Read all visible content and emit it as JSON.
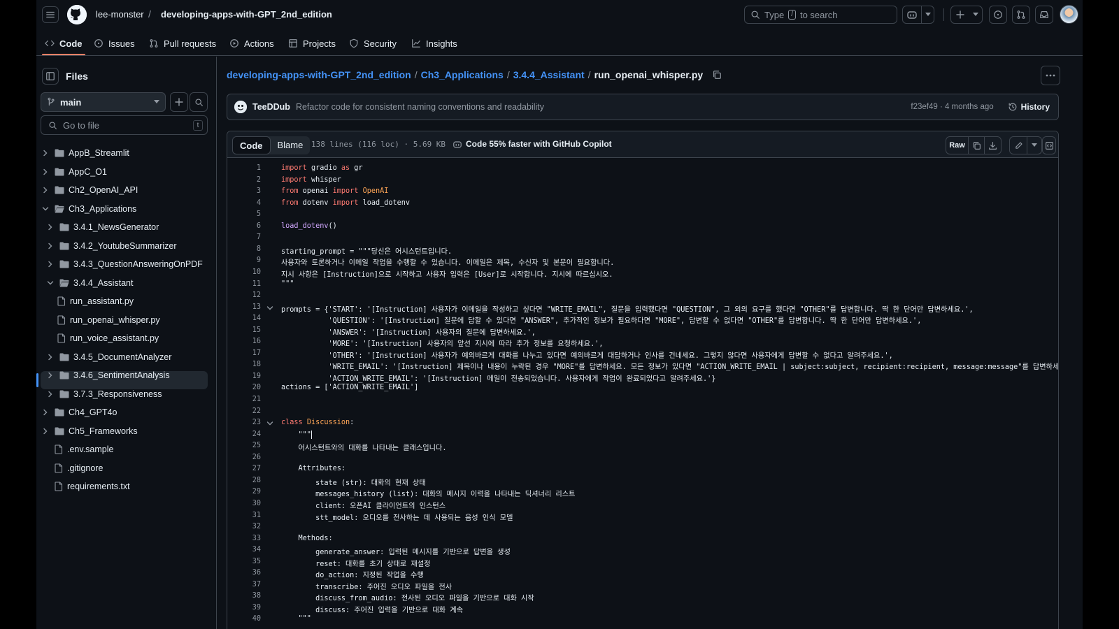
{
  "header": {
    "owner": "lee-monster",
    "separator": "/",
    "repo": "developing-apps-with-GPT_2nd_edition",
    "search_prefix": "Type",
    "search_key": "/",
    "search_suffix": "to search"
  },
  "repo_nav": {
    "tabs": [
      {
        "label": "Code",
        "icon": "code-icon"
      },
      {
        "label": "Issues",
        "icon": "issue-icon"
      },
      {
        "label": "Pull requests",
        "icon": "pull-request-icon"
      },
      {
        "label": "Actions",
        "icon": "play-icon"
      },
      {
        "label": "Projects",
        "icon": "table-icon"
      },
      {
        "label": "Security",
        "icon": "shield-icon"
      },
      {
        "label": "Insights",
        "icon": "graph-icon"
      }
    ]
  },
  "sidebar": {
    "title": "Files",
    "branch": "main",
    "goto_placeholder": "Go to file",
    "goto_key": "t",
    "tree": [
      {
        "label": "AppB_Streamlit",
        "type": "folder",
        "depth": 0,
        "expanded": false
      },
      {
        "label": "AppC_O1",
        "type": "folder",
        "depth": 0,
        "expanded": false
      },
      {
        "label": "Ch2_OpenAI_API",
        "type": "folder",
        "depth": 0,
        "expanded": false
      },
      {
        "label": "Ch3_Applications",
        "type": "folder",
        "depth": 0,
        "expanded": true
      },
      {
        "label": "3.4.1_NewsGenerator",
        "type": "folder",
        "depth": 1,
        "expanded": false
      },
      {
        "label": "3.4.2_YoutubeSummarizer",
        "type": "folder",
        "depth": 1,
        "expanded": false
      },
      {
        "label": "3.4.3_QuestionAnsweringOnPDF",
        "type": "folder",
        "depth": 1,
        "expanded": false
      },
      {
        "label": "3.4.4_Assistant",
        "type": "folder",
        "depth": 1,
        "expanded": true
      },
      {
        "label": "run_assistant.py",
        "type": "file",
        "depth": 2
      },
      {
        "label": "run_openai_whisper.py",
        "type": "file",
        "depth": 2,
        "selected": true
      },
      {
        "label": "run_voice_assistant.py",
        "type": "file",
        "depth": 2
      },
      {
        "label": "3.4.5_DocumentAnalyzer",
        "type": "folder",
        "depth": 1,
        "expanded": false
      },
      {
        "label": "3.4.6_SentimentAnalysis",
        "type": "folder",
        "depth": 1,
        "expanded": false
      },
      {
        "label": "3.7.3_Responsiveness",
        "type": "folder",
        "depth": 1,
        "expanded": false
      },
      {
        "label": "Ch4_GPT4o",
        "type": "folder",
        "depth": 0,
        "expanded": false
      },
      {
        "label": "Ch5_Frameworks",
        "type": "folder",
        "depth": 0,
        "expanded": false
      },
      {
        "label": ".env.sample",
        "type": "file",
        "depth": 0
      },
      {
        "label": ".gitignore",
        "type": "file",
        "depth": 0
      },
      {
        "label": "requirements.txt",
        "type": "file",
        "depth": 0
      }
    ]
  },
  "breadcrumb": {
    "parts": [
      "developing-apps-with-GPT_2nd_edition",
      "Ch3_Applications",
      "3.4.4_Assistant"
    ],
    "separator": "/",
    "current": "run_openai_whisper.py"
  },
  "commit": {
    "author": "TeeDDub",
    "message": "Refactor code for consistent naming conventions and readability",
    "meta": "f23ef49 · 4 months ago",
    "history_label": "History"
  },
  "file_bar": {
    "code_tab": "Code",
    "blame_tab": "Blame",
    "info": "138 lines (116 loc) · 5.69 KB",
    "copilot": "Code 55% faster with GitHub Copilot",
    "raw_label": "Raw"
  },
  "colors": {
    "bg": "#0d1117",
    "accent": "#4493f8",
    "tab_underline": "#f78166",
    "keyword": "#ff7b72",
    "function": "#d2a8ff",
    "string": "#a5d6ff"
  },
  "code_lines": [
    {
      "n": "1",
      "t": "import gradio as gr"
    },
    {
      "n": "2",
      "t": "import whisper"
    },
    {
      "n": "3",
      "t": "from openai import OpenAI"
    },
    {
      "n": "4",
      "t": "from dotenv import load_dotenv"
    },
    {
      "n": "5",
      "t": ""
    },
    {
      "n": "6",
      "t": "load_dotenv()"
    },
    {
      "n": "7",
      "t": ""
    },
    {
      "n": "8",
      "t": "starting_prompt = \"\"\"당신은 어시스턴트입니다."
    },
    {
      "n": "9",
      "t": "사용자와 토론하거나 이메일 작업을 수행할 수 있습니다. 이메일은 제목, 수신자 및 본문이 필요합니다."
    },
    {
      "n": "10",
      "t": "지시 사항은 [Instruction]으로 시작하고 사용자 입력은 [User]로 시작합니다. 지시에 따르십시오."
    },
    {
      "n": "11",
      "t": "\"\"\""
    },
    {
      "n": "12",
      "t": ""
    },
    {
      "n": "13",
      "t": "prompts = {'START': '[Instruction] 사용자가 이메일을 작성하고 싶다면 \"WRITE_EMAIL\", 질문을 입력했다면 \"QUESTION\", 그 외의 요구를 했다면 \"OTHER\"를 답변합니다. 딱 한 단어만 답변하세요.',"
    },
    {
      "n": "14",
      "t": "           'QUESTION': '[Instruction] 질문에 답할 수 있다면 \"ANSWER\", 추가적인 정보가 필요하다면 \"MORE\", 답변할 수 없다면 \"OTHER\"를 답변합니다. 딱 한 단어만 답변하세요.',"
    },
    {
      "n": "15",
      "t": "           'ANSWER': '[Instruction] 사용자의 질문에 답변하세요.',"
    },
    {
      "n": "16",
      "t": "           'MORE': '[Instruction] 사용자의 앞선 지시에 따라 추가 정보를 요청하세요.',"
    },
    {
      "n": "17",
      "t": "           'OTHER': '[Instruction] 사용자가 예의바르게 대화를 나누고 있다면 예의바르게 대답하거나 인사를 건네세요. 그렇지 않다면 사용자에게 답변할 수 없다고 알려주세요.',"
    },
    {
      "n": "18",
      "t": "           'WRITE_EMAIL': '[Instruction] 제목이나 내용이 누락된 경우 \"MORE\"를 답변하세요. 모든 정보가 있다면 \"ACTION_WRITE_EMAIL | subject:subject, recipient:recipient, message:message\"를 답변하세요.',"
    },
    {
      "n": "19",
      "t": "           'ACTION_WRITE_EMAIL': '[Instruction] 메일이 전송되었습니다. 사용자에게 작업이 완료되었다고 알려주세요.'}"
    },
    {
      "n": "20",
      "t": "actions = ['ACTION_WRITE_EMAIL']"
    },
    {
      "n": "21",
      "t": ""
    },
    {
      "n": "22",
      "t": ""
    },
    {
      "n": "23",
      "t": "class Discussion:"
    },
    {
      "n": "24",
      "t": "    \"\"\""
    },
    {
      "n": "25",
      "t": "    어시스턴트와의 대화를 나타내는 클래스입니다."
    },
    {
      "n": "26",
      "t": ""
    },
    {
      "n": "27",
      "t": "    Attributes:"
    },
    {
      "n": "28",
      "t": "        state (str): 대화의 현재 상태"
    },
    {
      "n": "29",
      "t": "        messages_history (list): 대화의 메시지 이력을 나타내는 딕셔너리 리스트"
    },
    {
      "n": "30",
      "t": "        client: 오픈AI 클라이언트의 인스턴스"
    },
    {
      "n": "31",
      "t": "        stt_model: 오디오를 전사하는 데 사용되는 음성 인식 모델"
    },
    {
      "n": "32",
      "t": ""
    },
    {
      "n": "33",
      "t": "    Methods:"
    },
    {
      "n": "34",
      "t": "        generate_answer: 입력된 메시지를 기반으로 답변을 생성"
    },
    {
      "n": "35",
      "t": "        reset: 대화를 초기 상태로 재설정"
    },
    {
      "n": "36",
      "t": "        do_action: 지정된 작업을 수행"
    },
    {
      "n": "37",
      "t": "        transcribe: 주어진 오디오 파일을 전사"
    },
    {
      "n": "38",
      "t": "        discuss_from_audio: 전사된 오디오 파일을 기반으로 대화 시작"
    },
    {
      "n": "39",
      "t": "        discuss: 주어진 입력을 기반으로 대화 계속"
    },
    {
      "n": "40",
      "t": "    \"\"\""
    }
  ]
}
